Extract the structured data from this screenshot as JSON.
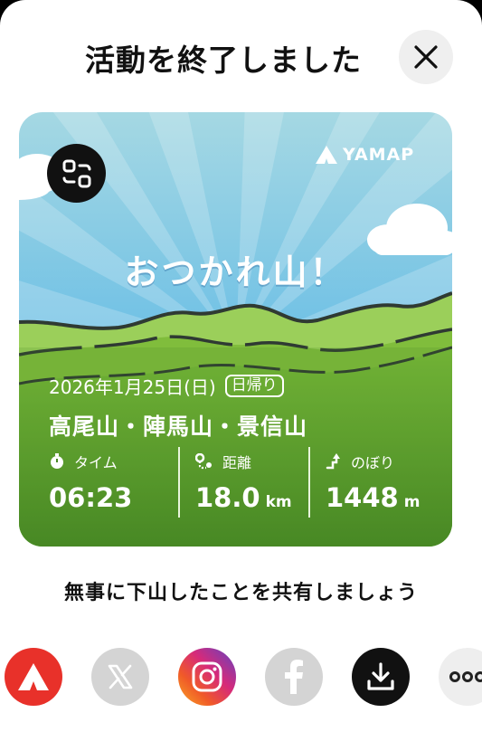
{
  "header": {
    "title": "活動を終了しました"
  },
  "card": {
    "brand": "YAMAP",
    "tagline": "おつかれ山！",
    "date": "2026年1月25日(日)",
    "day_type": "日帰り",
    "mountains": "高尾山・陣馬山・景信山",
    "stats": {
      "time": {
        "label": "タイム",
        "value": "06:23"
      },
      "distance": {
        "label": "距離",
        "value": "18.0",
        "unit": "km"
      },
      "climb": {
        "label": "のぼり",
        "value": "1448",
        "unit": "m"
      }
    }
  },
  "share": {
    "prompt": "無事に下山したことを共有しましょう",
    "targets": [
      "yamap-icon",
      "x-icon",
      "instagram-icon",
      "facebook-icon",
      "download-icon",
      "more-icon"
    ]
  },
  "colors": {
    "yamap_red": "#e8312a",
    "disabled_gray": "#d4d4d4",
    "sky_top": "#a5d8e3",
    "sky_bottom": "#4fb2e6",
    "grass": "#5a9a2e"
  }
}
